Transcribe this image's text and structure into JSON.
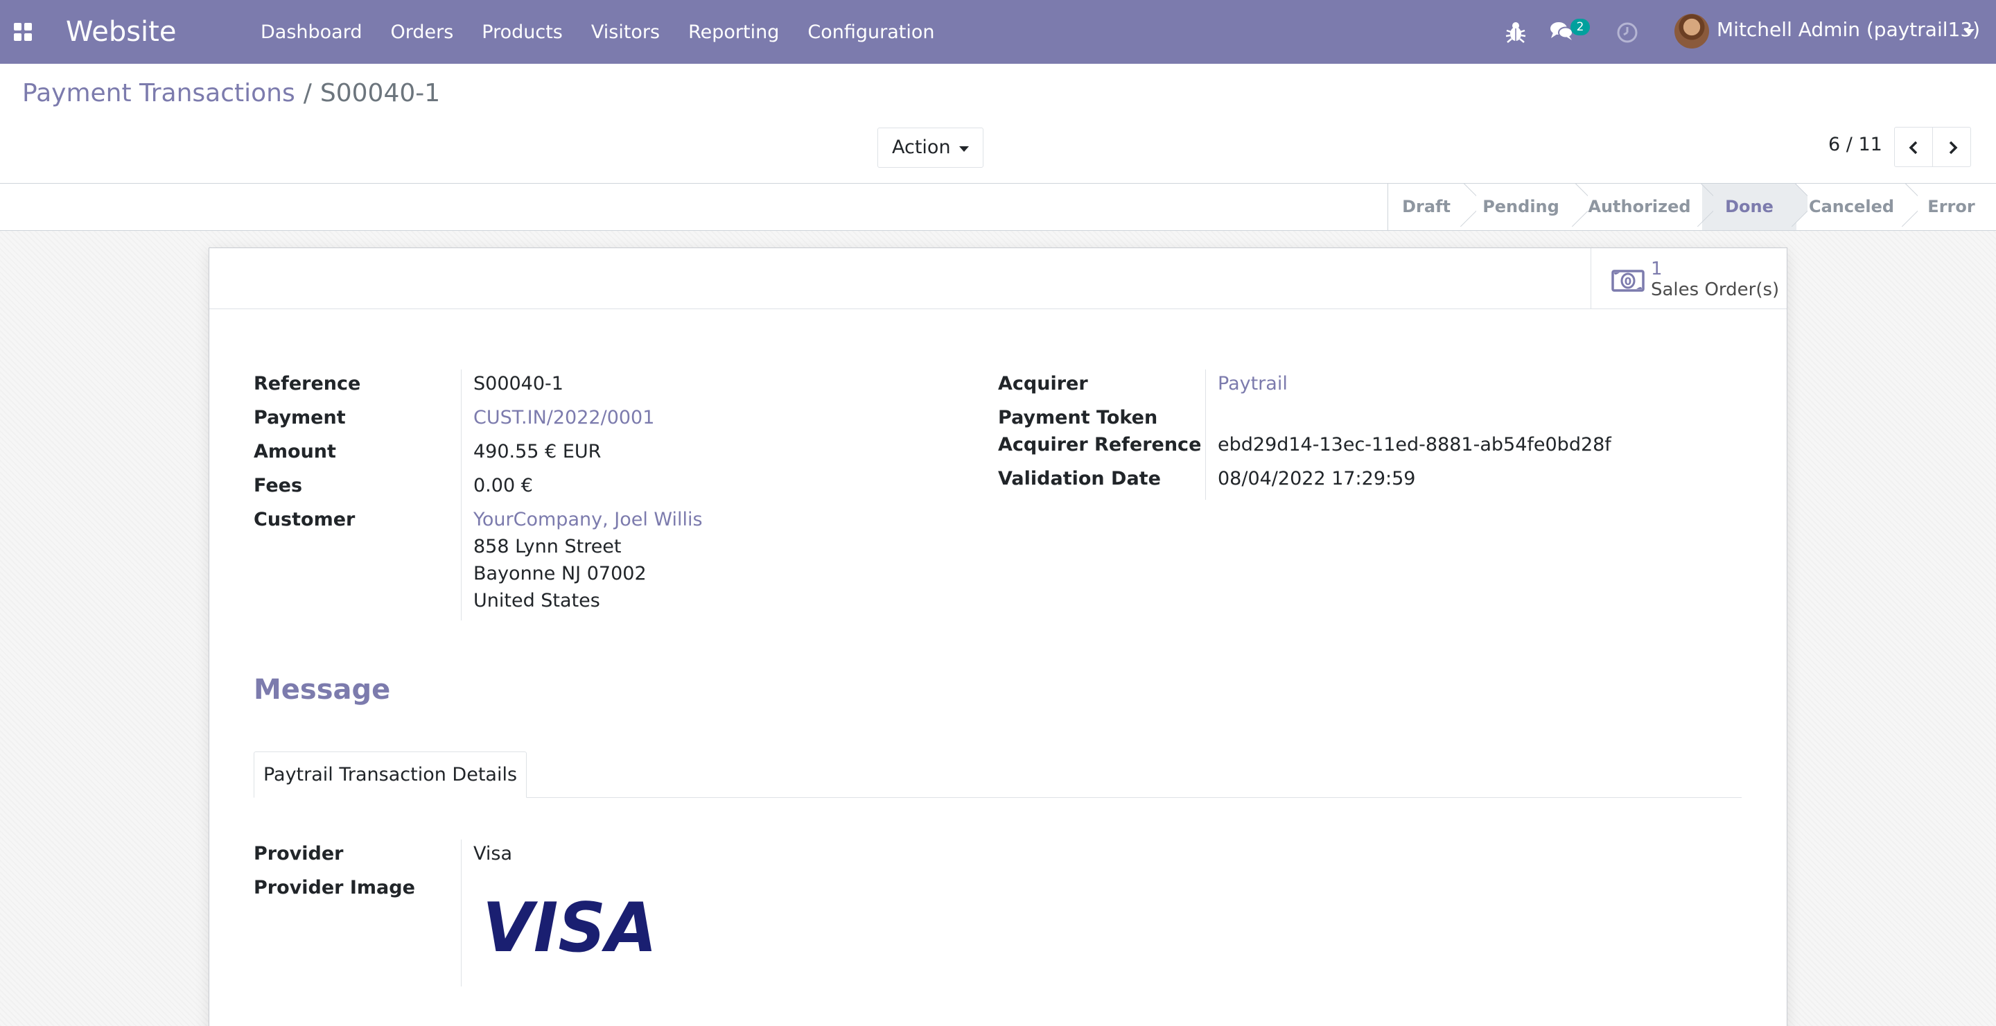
{
  "navbar": {
    "app_name": "Website",
    "menu": [
      "Dashboard",
      "Orders",
      "Products",
      "Visitors",
      "Reporting",
      "Configuration"
    ],
    "chat_count": "2",
    "user": "Mitchell Admin (paytrail13)"
  },
  "breadcrumb": {
    "parent": "Payment Transactions",
    "separator": "/",
    "current": "S00040-1"
  },
  "toolbar": {
    "action_label": "Action",
    "pager": "6 / 11"
  },
  "statusbar": {
    "steps": [
      "Draft",
      "Pending",
      "Authorized",
      "Done",
      "Canceled",
      "Error"
    ],
    "active": "Done"
  },
  "smart_button": {
    "count": "1",
    "label": "Sales Order(s)"
  },
  "form": {
    "left": {
      "reference_label": "Reference",
      "reference_value": "S00040-1",
      "payment_label": "Payment",
      "payment_value": "CUST.IN/2022/0001",
      "amount_label": "Amount",
      "amount_value": "490.55 € EUR",
      "fees_label": "Fees",
      "fees_value": "0.00 €",
      "customer_label": "Customer",
      "customer_name": "YourCompany, Joel Willis",
      "customer_address": [
        "858 Lynn Street",
        "Bayonne NJ 07002",
        "United States"
      ]
    },
    "right": {
      "acquirer_label": "Acquirer",
      "acquirer_value": "Paytrail",
      "token_label": "Payment Token",
      "acq_ref_label": "Acquirer Reference",
      "acq_ref_value": "ebd29d14-13ec-11ed-8881-ab54fe0bd28f",
      "validation_label": "Validation Date",
      "validation_value": "08/04/2022 17:29:59"
    },
    "message_title": "Message",
    "tab_label": "Paytrail Transaction Details",
    "details": {
      "provider_label": "Provider",
      "provider_value": "Visa",
      "provider_image_label": "Provider Image",
      "provider_image_text": "VISA"
    }
  },
  "colors": {
    "brand": "#7c7bad",
    "badge": "#00a09d",
    "visa_blue": "#1a1f71"
  }
}
